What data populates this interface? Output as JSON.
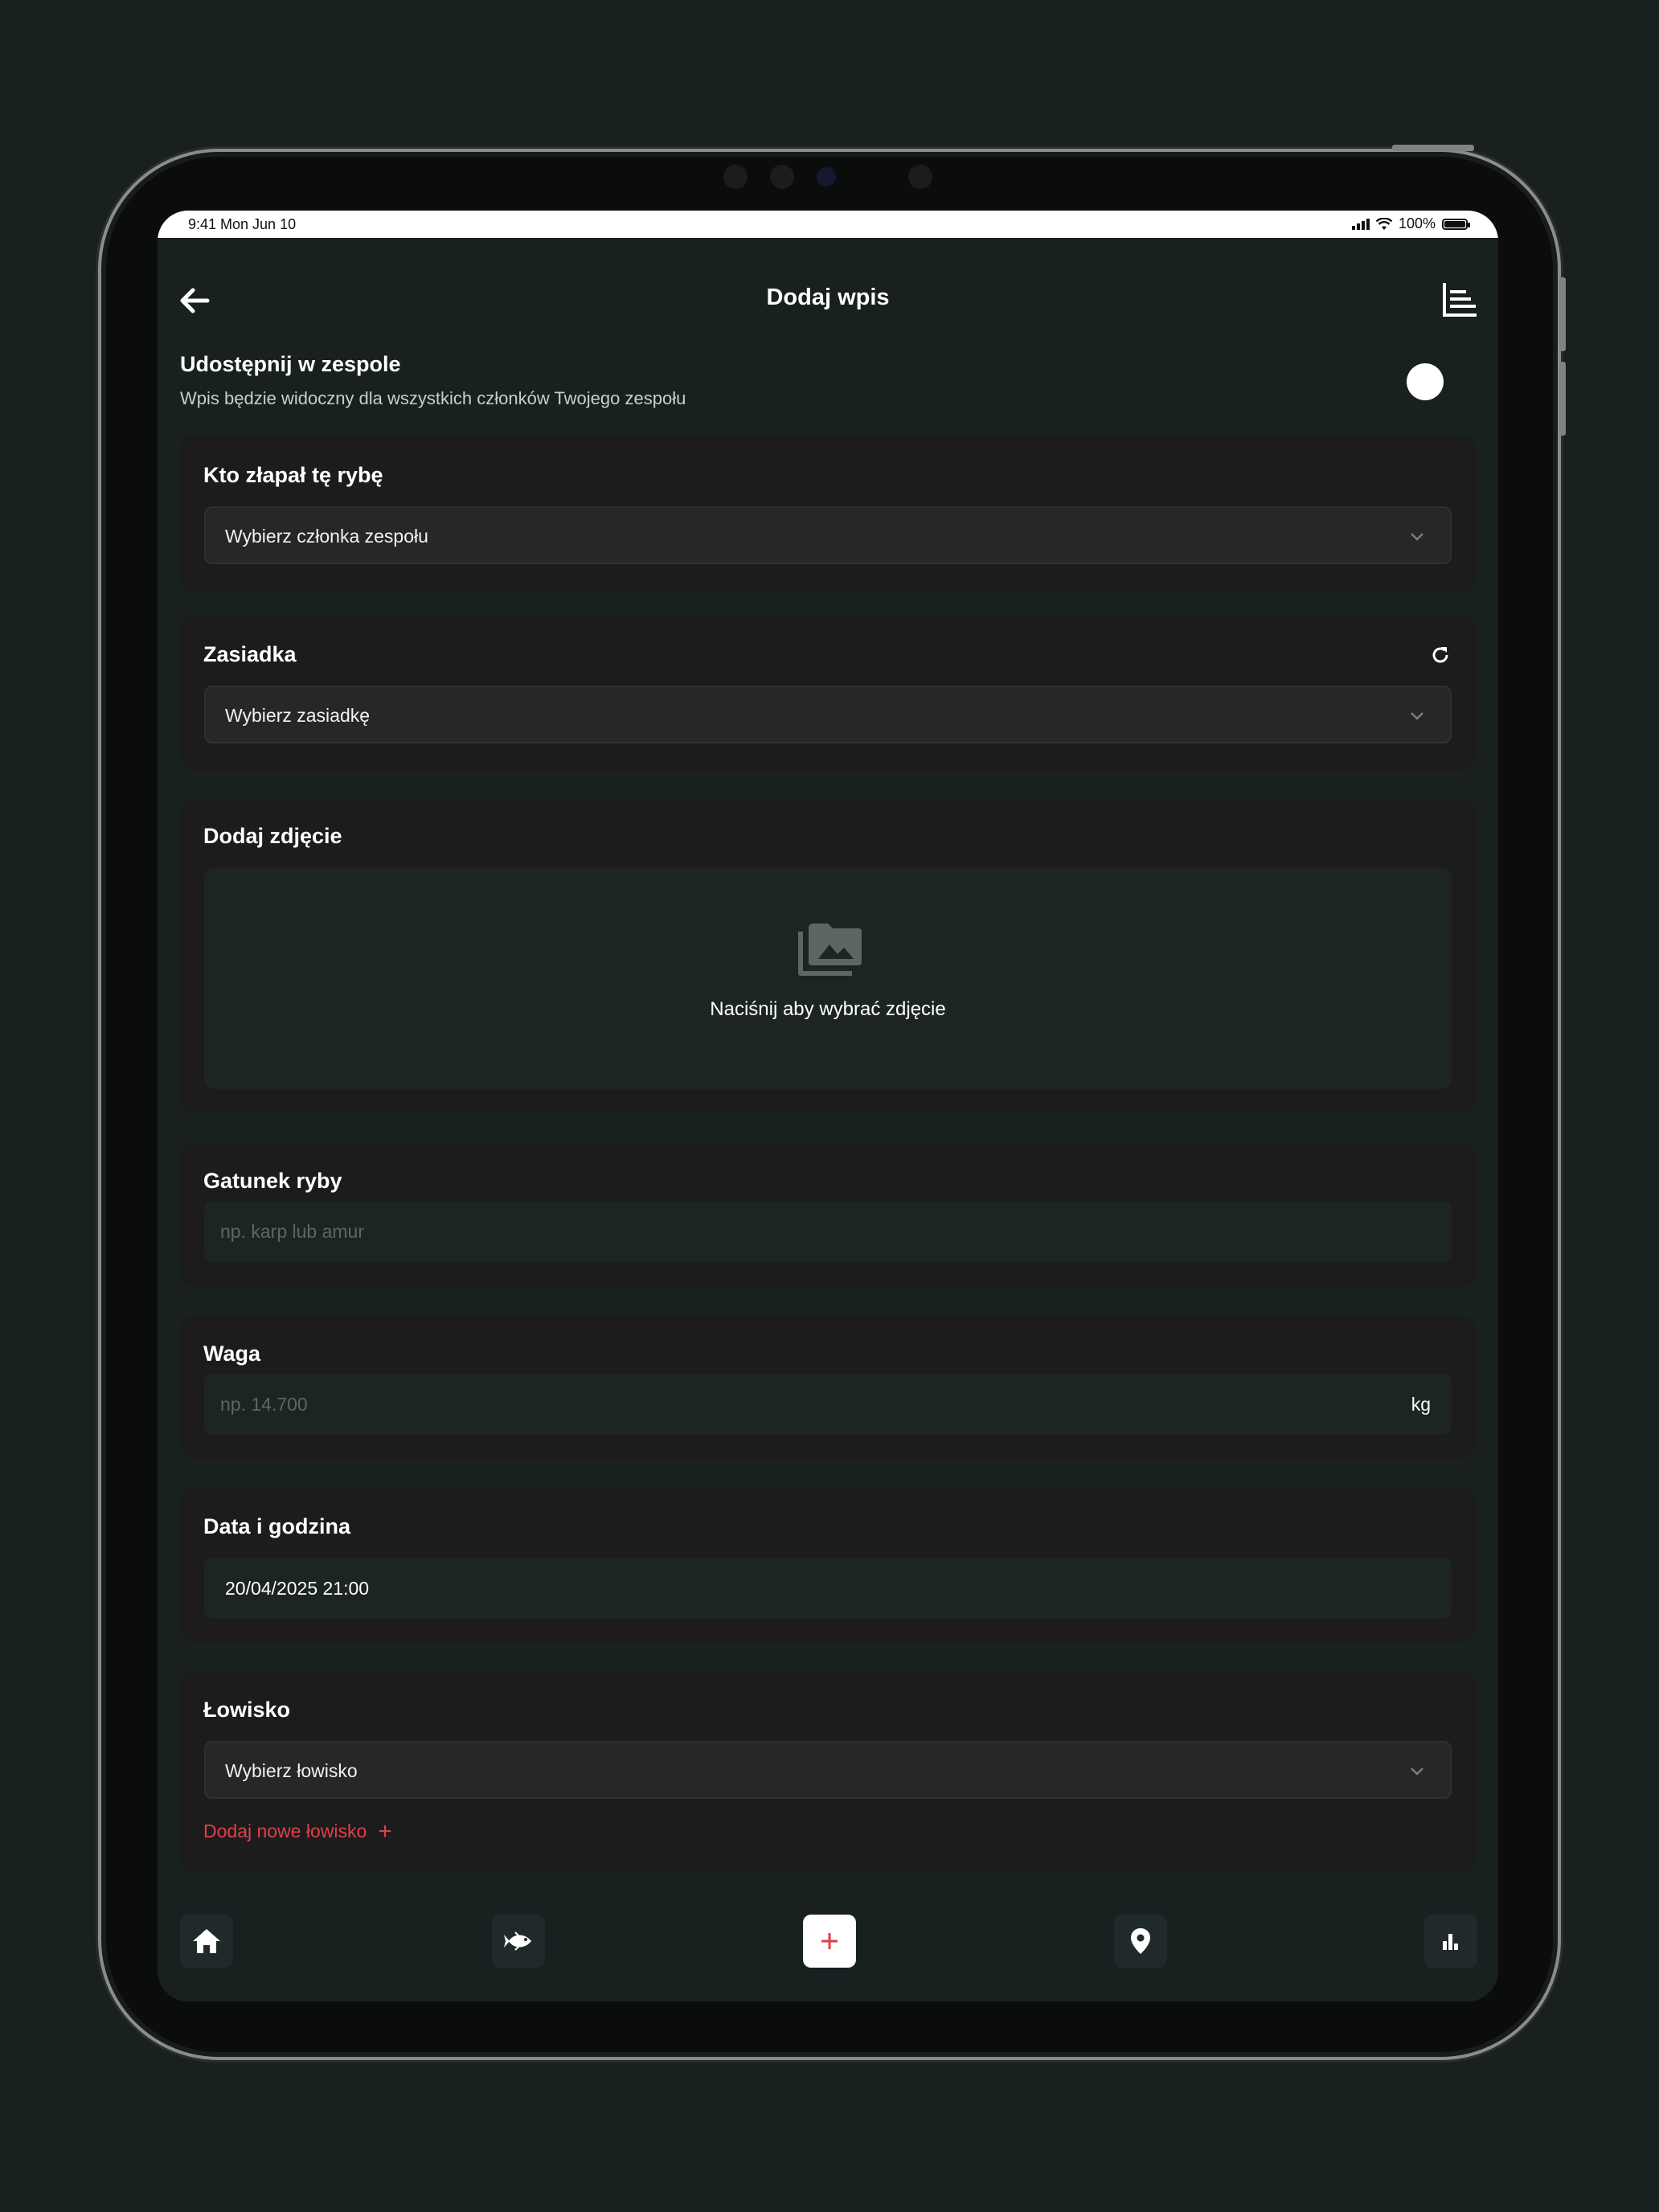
{
  "status_bar": {
    "time": "9:41  Mon Jun 10",
    "battery": "100%"
  },
  "header": {
    "title": "Dodaj wpis",
    "back_icon": "arrow-left-icon",
    "stats_icon": "bar-list-icon"
  },
  "share": {
    "title": "Udostępnij w zespole",
    "description": "Wpis będzie widoczny dla wszystkich członków Twojego zespołu",
    "toggle_on": false
  },
  "catcher": {
    "label": "Kto złapał tę rybę",
    "value": "Wybierz członka zespołu"
  },
  "session": {
    "label": "Zasiadka",
    "value": "Wybierz zasiadkę",
    "refresh_icon": "refresh-icon"
  },
  "photo": {
    "label": "Dodaj zdjęcie",
    "hint": "Naciśnij aby wybrać zdjęcie",
    "icon": "photo-library-icon"
  },
  "species": {
    "label": "Gatunek ryby",
    "placeholder": "np. karp lub amur"
  },
  "weight": {
    "label": "Waga",
    "placeholder": "np. 14.700",
    "unit": "kg"
  },
  "datetime": {
    "label": "Data i godzina",
    "value": "20/04/2025 21:00"
  },
  "fishery": {
    "label": "Łowisko",
    "value": "Wybierz łowisko",
    "add_label": "Dodaj nowe łowisko",
    "add_icon": "plus-icon"
  },
  "colors": {
    "accent": "#e0404a",
    "background": "#182020",
    "card": "#1c1c1c"
  },
  "tabbar": {
    "items": [
      "home-icon",
      "fish-icon",
      "add-icon",
      "location-pin-icon",
      "bar-chart-icon"
    ],
    "active": "add-icon"
  }
}
